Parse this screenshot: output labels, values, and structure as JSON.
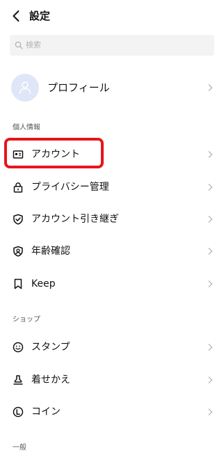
{
  "header": {
    "title": "設定"
  },
  "search": {
    "placeholder": "検索"
  },
  "profile": {
    "label": "プロフィール"
  },
  "sections": {
    "personal": {
      "title": "個人情報",
      "items": [
        {
          "label": "アカウント",
          "icon": "id-card-icon"
        },
        {
          "label": "プライバシー管理",
          "icon": "lock-icon"
        },
        {
          "label": "アカウント引き継ぎ",
          "icon": "shield-check-icon"
        },
        {
          "label": "年齢確認",
          "icon": "age-shield-icon"
        },
        {
          "label": "Keep",
          "icon": "bookmark-icon"
        }
      ]
    },
    "shop": {
      "title": "ショップ",
      "items": [
        {
          "label": "スタンプ",
          "icon": "smiley-icon"
        },
        {
          "label": "着せかえ",
          "icon": "theme-stamp-icon"
        },
        {
          "label": "コイン",
          "icon": "coin-icon"
        }
      ]
    },
    "general": {
      "title": "一般"
    }
  },
  "highlight": {
    "color": "#e8141c",
    "target": "アカウント"
  }
}
